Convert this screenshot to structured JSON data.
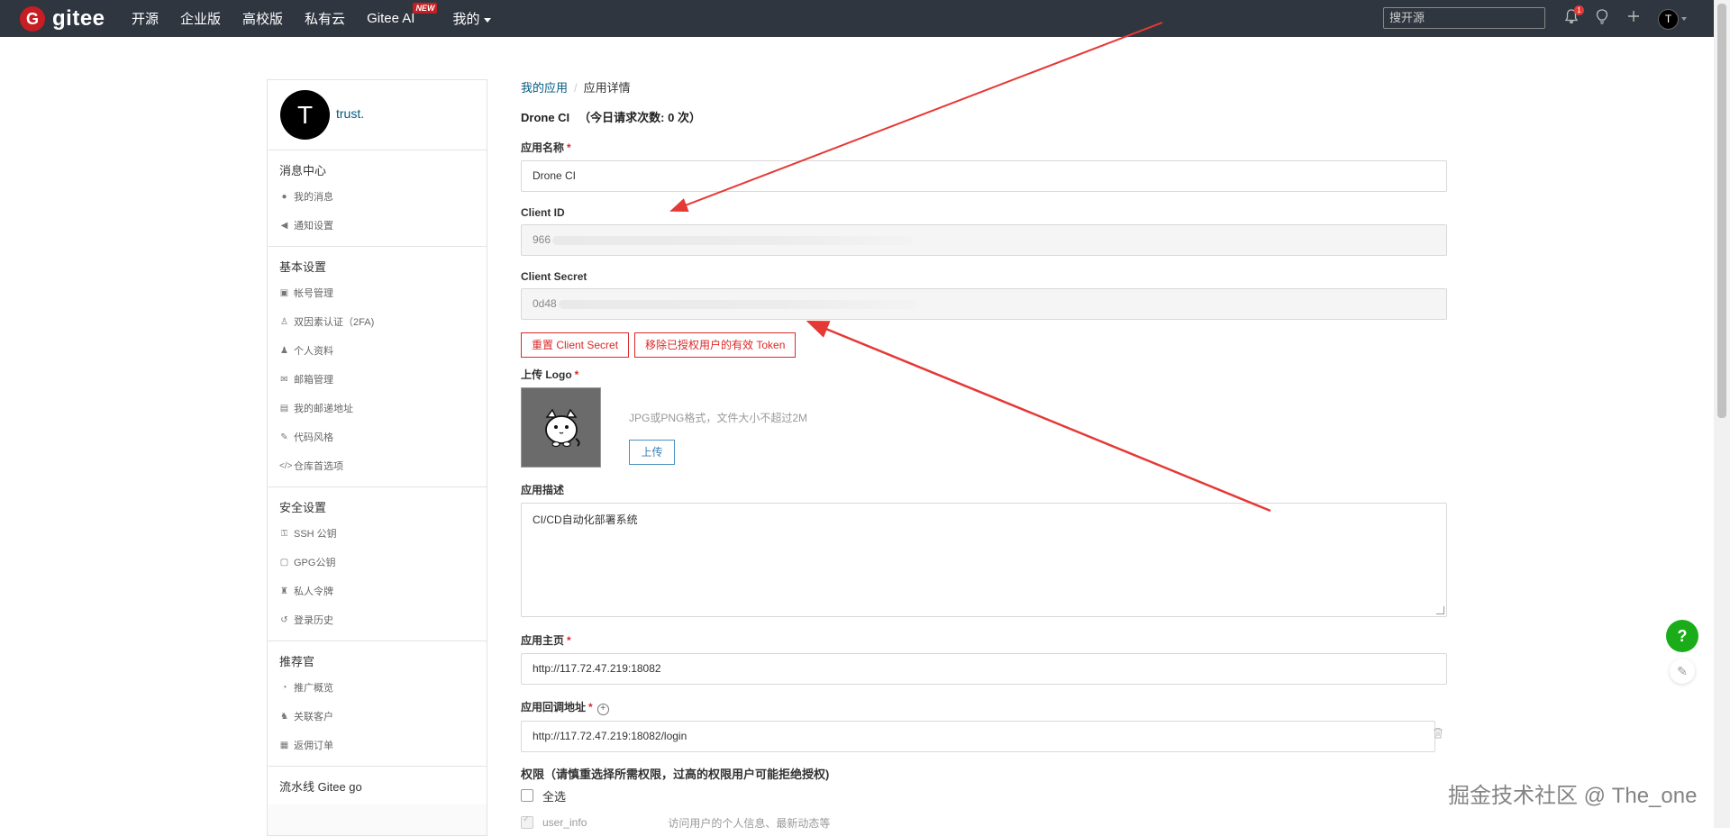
{
  "nav": {
    "logo_text": "gitee",
    "items": [
      "开源",
      "企业版",
      "高校版",
      "私有云",
      "Gitee AI",
      "我的"
    ],
    "new_badge": "NEW",
    "search_placeholder": "搜开源",
    "bell_count": "1",
    "avatar_letter": "T"
  },
  "sidebar": {
    "avatar_letter": "T",
    "username": "trust.",
    "groups": [
      {
        "title": "消息中心",
        "items": [
          {
            "icon": "bell-icon",
            "label": "我的消息"
          },
          {
            "icon": "speaker-icon",
            "label": "通知设置"
          }
        ]
      },
      {
        "title": "基本设置",
        "items": [
          {
            "icon": "id-card-icon",
            "label": "帐号管理"
          },
          {
            "icon": "two-factor-icon",
            "label": "双因素认证（2FA)"
          },
          {
            "icon": "user-icon",
            "label": "个人资料"
          },
          {
            "icon": "mail-icon",
            "label": "邮箱管理"
          },
          {
            "icon": "address-icon",
            "label": "我的邮递地址"
          },
          {
            "icon": "brush-icon",
            "label": "代码风格"
          },
          {
            "icon": "code-icon",
            "label": "仓库首选项"
          }
        ]
      },
      {
        "title": "安全设置",
        "items": [
          {
            "icon": "key-icon",
            "label": "SSH 公钥"
          },
          {
            "icon": "lock-icon",
            "label": "GPG公钥"
          },
          {
            "icon": "token-icon",
            "label": "私人令牌"
          },
          {
            "icon": "history-icon",
            "label": "登录历史"
          }
        ]
      },
      {
        "title": "推荐官",
        "items": [
          {
            "icon": "pie-icon",
            "label": "推广概览"
          },
          {
            "icon": "customer-icon",
            "label": "关联客户"
          },
          {
            "icon": "order-icon",
            "label": "返佣订单"
          }
        ]
      },
      {
        "title": "流水线 Gitee go",
        "items": []
      }
    ]
  },
  "main": {
    "breadcrumb": {
      "link": "我的应用",
      "current": "应用详情"
    },
    "app_name_title": "Drone CI",
    "request_count": "（今日请求次数: 0 次）",
    "fields": {
      "name_label": "应用名称",
      "name_value": "Drone CI",
      "client_id_label": "Client ID",
      "client_id_prefix": "966",
      "client_secret_label": "Client Secret",
      "client_secret_prefix": "0d48",
      "reset_secret_btn": "重置 Client Secret",
      "revoke_tokens_btn": "移除已授权用户的有效 Token",
      "logo_label": "上传 Logo",
      "logo_hint": "JPG或PNG格式，文件大小不超过2M",
      "upload_btn": "上传",
      "desc_label": "应用描述",
      "desc_value": "CI/CD自动化部署系统",
      "homepage_label": "应用主页",
      "homepage_value": "http://117.72.47.219:18082",
      "callback_label": "应用回调地址",
      "callback_value": "http://117.72.47.219:18082/login",
      "perm_label": "权限（请慎重选择所需权限，过高的权限用户可能拒绝授权)",
      "select_all": "全选",
      "perm_user_info": "user_info",
      "perm_user_info_desc": "访问用户的个人信息、最新动态等"
    }
  },
  "help": {
    "question": "?"
  },
  "watermark": "掘金技术社区 @ The_one",
  "colors": {
    "nav_bg": "#2f3640",
    "brand_red": "#c71d23",
    "link": "#005980",
    "danger": "#db2828",
    "help_green": "#1aad19"
  }
}
